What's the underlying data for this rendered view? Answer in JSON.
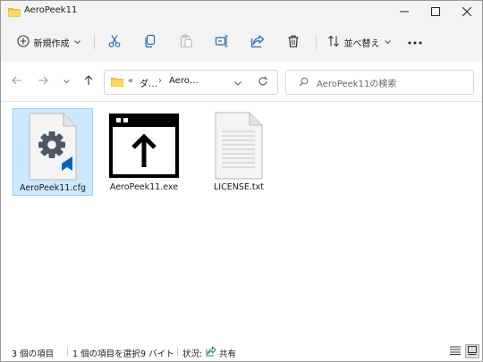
{
  "window": {
    "title": "AeroPeek11"
  },
  "toolbar": {
    "new_label": "新規作成",
    "sort_label": "並べ替え"
  },
  "address": {
    "overflow": "«",
    "crumbs": [
      "ダ…",
      "Aero…"
    ]
  },
  "search": {
    "placeholder": "AeroPeek11の検索"
  },
  "files": [
    {
      "name": "AeroPeek11.cfg",
      "selected": true
    },
    {
      "name": "AeroPeek11.exe",
      "selected": false
    },
    {
      "name": "LICENSE.txt",
      "selected": false
    }
  ],
  "status": {
    "item_count": "3 個の項目",
    "selection": "1 個の項目を選択",
    "size": "9 バイト",
    "state_label": "状況:",
    "share_label": "共有"
  },
  "colors": {
    "selection": "#cce8ff",
    "selection_border": "#99d1ff",
    "folder": "#f5c542",
    "accent": "#0067c0"
  }
}
